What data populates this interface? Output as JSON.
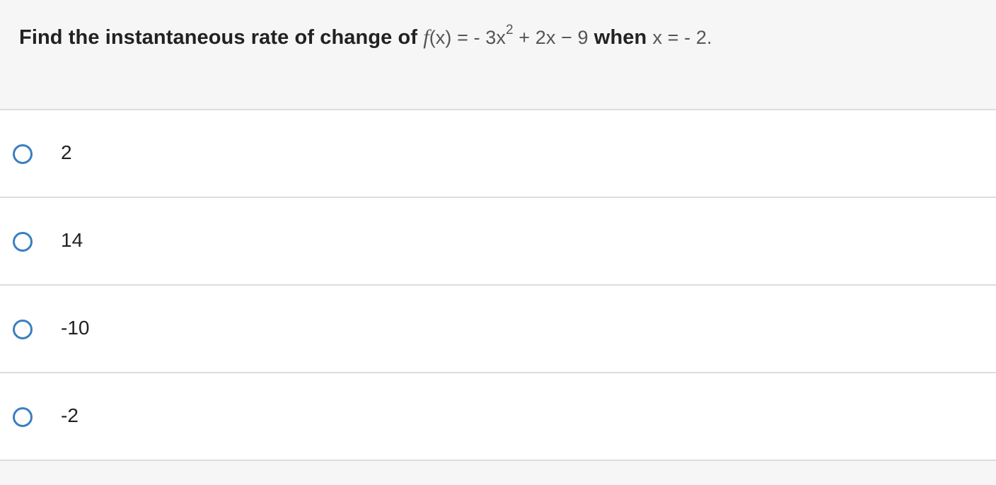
{
  "question": {
    "prefix": "Find the instantaneous rate of change of ",
    "function_name": "f",
    "function_arg": "(x)",
    "equals": " = - 3x",
    "exponent": "2",
    "rest": " + 2x − 9",
    "when": " when ",
    "condition": "x = - 2."
  },
  "options": [
    {
      "label": "2",
      "selected": false
    },
    {
      "label": "14",
      "selected": false
    },
    {
      "label": "-10",
      "selected": false
    },
    {
      "label": "-2",
      "selected": false
    }
  ],
  "colors": {
    "radio_border": "#3a7fc1",
    "question_bg": "#f6f6f6",
    "divider": "#dcdce0"
  }
}
